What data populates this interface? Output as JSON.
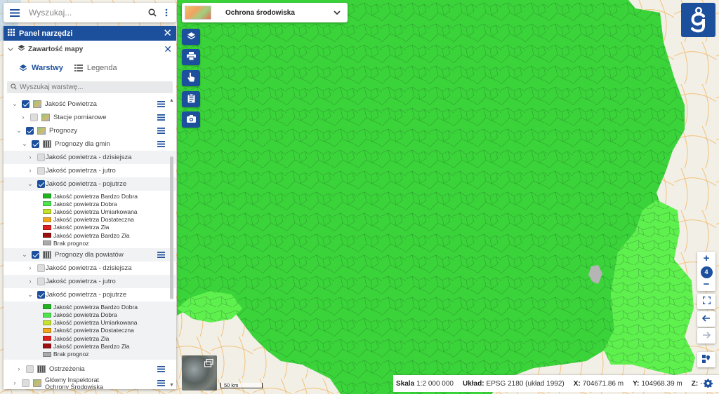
{
  "search": {
    "placeholder": "Wyszukaj..."
  },
  "panel": {
    "title": "Panel narzędzi",
    "section": "Zawartość mapy",
    "tabs": [
      "Warstwy",
      "Legenda"
    ],
    "layer_search_placeholder": "Wyszukaj warstwę..."
  },
  "tree": {
    "jakosc_powietrza": "Jakość Powietrza",
    "stacje": "Stacje pomiarowe",
    "prognozy": "Prognozy",
    "prognozy_gmin": "Prognozy dla gmin",
    "gmin_dzisiejsza": "Jakość powietrza - dzisiejsza",
    "gmin_jutro": "Jakość powietrza - jutro",
    "gmin_pojutrze": "Jakość powietrza - pojutrze",
    "prognozy_powiatow": "Prognozy dla powiatów",
    "pow_dzisiejsza": "Jakość powietrza - dzisiejsza",
    "pow_jutro": "Jakość powietrza - jutro",
    "pow_pojutrze": "Jakość powietrza - pojutrze",
    "ostrzezenia": "Ostrzeżenia",
    "gios": "Główny Inspektorat Ochrony Środowiska"
  },
  "legend_gmin": [
    {
      "label": "Jakość powietrza Bardzo Dobra",
      "color": "#21b421"
    },
    {
      "label": "Jakość powietrza Dobra",
      "color": "#4de44d"
    },
    {
      "label": "Jakość powietrza Umiarkowana",
      "color": "#c6e22c"
    },
    {
      "label": "Jakość powietrza Dostateczna",
      "color": "#f2a81d"
    },
    {
      "label": "Jakość powietrza Zła",
      "color": "#e01f1f"
    },
    {
      "label": "Jakość powietrza Bardzo Zła",
      "color": "#9c1010"
    },
    {
      "label": "Brak prognoz",
      "color": "#aaaaaa"
    }
  ],
  "legend_powiatow": [
    {
      "label": "Jakość powietrza Bardzo Dobra",
      "color": "#21b421"
    },
    {
      "label": "Jakość powietrza Dobra",
      "color": "#4de44d"
    },
    {
      "label": "Jakość powietrza Umiarkowana",
      "color": "#c6e22c"
    },
    {
      "label": "Jakość powietrza Dostateczna",
      "color": "#f2a81d"
    },
    {
      "label": "Jakość powietrza Zła",
      "color": "#e01f1f"
    },
    {
      "label": "Jakość powietrza Bardzo Zła",
      "color": "#9c1010"
    },
    {
      "label": "Brak prognoz",
      "color": "#aaaaaa"
    }
  ],
  "theme": {
    "name": "Ochrona środowiska"
  },
  "zoom": {
    "level": "4"
  },
  "scale_bar": "50 km",
  "status": {
    "scale_label": "Skala",
    "scale_value": "1:2 000 000",
    "crs_label": "Układ:",
    "crs_value": "EPSG 2180 (układ 1992)",
    "x_label": "X:",
    "x_value": "704671.86 m",
    "y_label": "Y:",
    "y_value": "104968.39 m",
    "z_label": "Z:",
    "z_value": "-"
  },
  "colors": {
    "accent": "#1c4f9c",
    "map_good": "#35c935",
    "map_very_good": "#5eea4f"
  }
}
